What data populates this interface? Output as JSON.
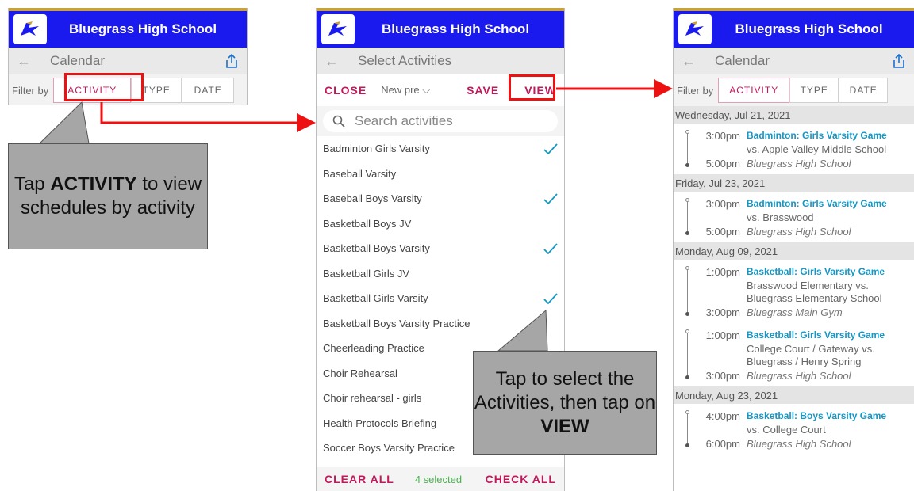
{
  "school_name": "Bluegrass High School",
  "colors": {
    "header_blue": "#1a1aee",
    "accent_pink": "#c2185b",
    "highlight_red": "#ee1111",
    "event_blue": "#1597c4",
    "gold": "#c9a13b"
  },
  "calendar": {
    "title": "Calendar",
    "filter_label": "Filter by",
    "filters": [
      "ACTIVITY",
      "TYPE",
      "DATE"
    ]
  },
  "select": {
    "title": "Select Activities",
    "close": "CLOSE",
    "preset": "New pre",
    "save": "SAVE",
    "view": "VIEW",
    "search_placeholder": "Search activities",
    "items": [
      {
        "label": "Badminton Girls Varsity",
        "checked": true
      },
      {
        "label": "Baseball Varsity",
        "checked": false
      },
      {
        "label": "Baseball Boys Varsity",
        "checked": true
      },
      {
        "label": "Basketball Boys JV",
        "checked": false
      },
      {
        "label": "Basketball Boys Varsity",
        "checked": true
      },
      {
        "label": "Basketball Girls JV",
        "checked": false
      },
      {
        "label": "Basketball Girls Varsity",
        "checked": true
      },
      {
        "label": "Basketball Boys Varsity Practice",
        "checked": false
      },
      {
        "label": "Cheerleading Practice",
        "checked": false
      },
      {
        "label": "Choir Rehearsal",
        "checked": false
      },
      {
        "label": "Choir rehearsal - girls",
        "checked": false
      },
      {
        "label": "Health Protocols Briefing",
        "checked": false
      },
      {
        "label": "Soccer Boys Varsity Practice",
        "checked": false
      }
    ],
    "clear_all": "CLEAR ALL",
    "selected_count": "4 selected",
    "check_all": "CHECK ALL"
  },
  "events": {
    "days": [
      {
        "date": "Wednesday, Jul 21, 2021",
        "events": [
          {
            "start": "3:00pm",
            "end": "5:00pm",
            "title": "Badminton: Girls Varsity Game",
            "desc": "vs. Apple Valley Middle School",
            "loc": "Bluegrass High School"
          }
        ]
      },
      {
        "date": "Friday, Jul 23, 2021",
        "events": [
          {
            "start": "3:00pm",
            "end": "5:00pm",
            "title": "Badminton: Girls Varsity Game",
            "desc": "vs. Brasswood",
            "loc": "Bluegrass High School"
          }
        ]
      },
      {
        "date": "Monday, Aug 09, 2021",
        "events": [
          {
            "start": "1:00pm",
            "end": "3:00pm",
            "title": "Basketball: Girls Varsity Game",
            "desc": "Brasswood Elementary vs. Bluegrass Elementary School",
            "loc": "Bluegrass Main Gym"
          },
          {
            "start": "1:00pm",
            "end": "3:00pm",
            "title": "Basketball: Girls Varsity Game",
            "desc": "College Court / Gateway vs. Bluegrass / Henry Spring",
            "loc": "Bluegrass High School"
          }
        ]
      },
      {
        "date": "Monday, Aug 23, 2021",
        "events": [
          {
            "start": "4:00pm",
            "end": "6:00pm",
            "title": "Basketball: Boys Varsity Game",
            "desc": "vs. College Court",
            "loc": "Bluegrass High School"
          }
        ]
      }
    ]
  },
  "callouts": {
    "left_pre": "Tap ",
    "left_bold": "ACTIVITY",
    "left_post": " to view schedules by activity",
    "mid_pre": "Tap to select the Activities, then tap on ",
    "mid_bold": "VIEW"
  },
  "icons": [
    "logo-bird-icon",
    "back-arrow-icon",
    "share-icon",
    "search-icon",
    "checkmark-icon",
    "chevron-down-icon"
  ]
}
